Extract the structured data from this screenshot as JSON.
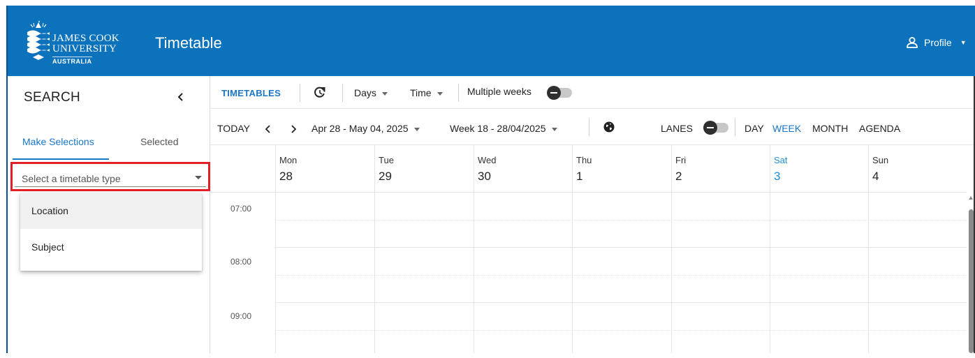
{
  "header": {
    "logo_line1": "JAMES COOK",
    "logo_line2": "UNIVERSITY",
    "logo_line3": "AUSTRALIA",
    "title": "Timetable",
    "profile_label": "Profile",
    "background_color": "#0b72bb"
  },
  "sidebar": {
    "title": "SEARCH",
    "collapse_icon": "‹",
    "tabs": [
      {
        "label": "Make Selections",
        "active": true
      },
      {
        "label": "Selected",
        "active": false
      }
    ],
    "select_placeholder": "Select a timetable type",
    "options": [
      {
        "label": "Location",
        "highlighted": true
      },
      {
        "label": "Subject",
        "highlighted": false
      }
    ],
    "highlight_color": "#e31e24"
  },
  "toolbar": {
    "timetables_label": "TIMETABLES",
    "days_label": "Days",
    "time_label": "Time",
    "multiple_weeks_label": "Multiple weeks",
    "today_label": "TODAY",
    "date_range": "Apr 28 - May 04, 2025",
    "week_label": "Week 18 - 28/04/2025",
    "lanes_label": "LANES",
    "views": [
      {
        "label": "DAY",
        "active": false
      },
      {
        "label": "WEEK",
        "active": true
      },
      {
        "label": "MONTH",
        "active": false
      },
      {
        "label": "AGENDA",
        "active": false
      }
    ],
    "accent_color": "#1976c9"
  },
  "calendar": {
    "days": [
      {
        "name": "Mon",
        "date": "28",
        "today": false
      },
      {
        "name": "Tue",
        "date": "29",
        "today": false
      },
      {
        "name": "Wed",
        "date": "30",
        "today": false
      },
      {
        "name": "Thu",
        "date": "1",
        "today": false
      },
      {
        "name": "Fri",
        "date": "2",
        "today": false
      },
      {
        "name": "Sat",
        "date": "3",
        "today": true
      },
      {
        "name": "Sun",
        "date": "4",
        "today": false
      }
    ],
    "times": [
      "07:00",
      "08:00",
      "09:00"
    ]
  }
}
